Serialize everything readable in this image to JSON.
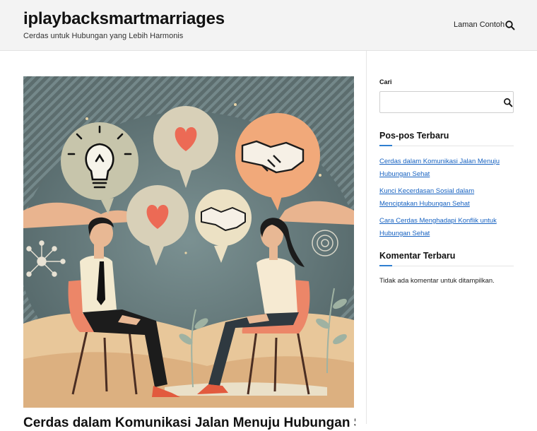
{
  "header": {
    "site_title": "iplaybacksmartmarriages",
    "tagline": "Cerdas untuk Hubungan yang Lebih Harmonis",
    "nav_link": "Laman Contoh"
  },
  "post": {
    "title": "Cerdas dalam Komunikasi Jalan Menuju Hubungan Sehat"
  },
  "sidebar": {
    "search_label": "Cari",
    "search_value": "",
    "recent_posts_title": "Pos-pos Terbaru",
    "recent_posts": [
      "Cerdas dalam Komunikasi Jalan Menuju Hubungan Sehat",
      "Kunci Kecerdasan Sosial dalam Menciptakan Hubungan Sehat",
      "Cara Cerdas Menghadapi Konflik untuk Hubungan Sehat"
    ],
    "recent_comments_title": "Komentar Terbaru",
    "no_comments_text": "Tidak ada komentar untuk ditampilkan."
  },
  "colors": {
    "accent": "#2f7fd0",
    "link": "#1762c1",
    "header_bg": "#f3f3f3"
  }
}
